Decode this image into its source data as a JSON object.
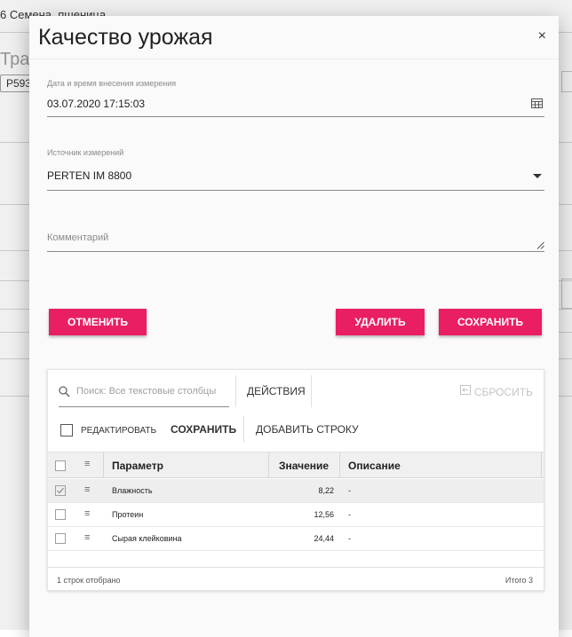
{
  "background": {
    "breadcrumb": "6 Семена, пшеница",
    "title_fragment": "Тран",
    "chip": "P593"
  },
  "dialog": {
    "title": "Качество урожая",
    "close_glyph": "×",
    "measurement_datetime": {
      "label": "Дата и время внесения измерения",
      "value": "03.07.2020 17:15:03",
      "icon": "calendar-icon"
    },
    "source": {
      "label": "Источник измерений",
      "value": "PERTEN IM 8800",
      "icon": "chevron-down-icon"
    },
    "comment": {
      "placeholder": "Комментарий",
      "value": ""
    },
    "buttons": {
      "cancel": "Отменить",
      "delete": "Удалить",
      "save": "Сохранить"
    },
    "accent_color": "#e91e63"
  },
  "grid": {
    "search_placeholder": "Поиск: Все текстовые столбцы",
    "actions_label": "ДЕЙСТВИЯ",
    "reset_label": "СБРОСИТЬ",
    "edit_label": "РЕДАКТИРОВАТЬ",
    "save_label": "СОХРАНИТЬ",
    "add_row_label": "ДОБАВИТЬ СТРОКУ",
    "columns": {
      "param": "Параметр",
      "value": "Значение",
      "description": "Описание"
    },
    "rows": [
      {
        "param": "Влажность",
        "value": "8,22",
        "description": "-",
        "selected": true
      },
      {
        "param": "Протеин",
        "value": "12,56",
        "description": "-",
        "selected": false
      },
      {
        "param": "Сырая клейковина",
        "value": "24,44",
        "description": "-",
        "selected": false
      }
    ],
    "footer_left": "1 строк отобрано",
    "footer_right": "Итого 3"
  }
}
